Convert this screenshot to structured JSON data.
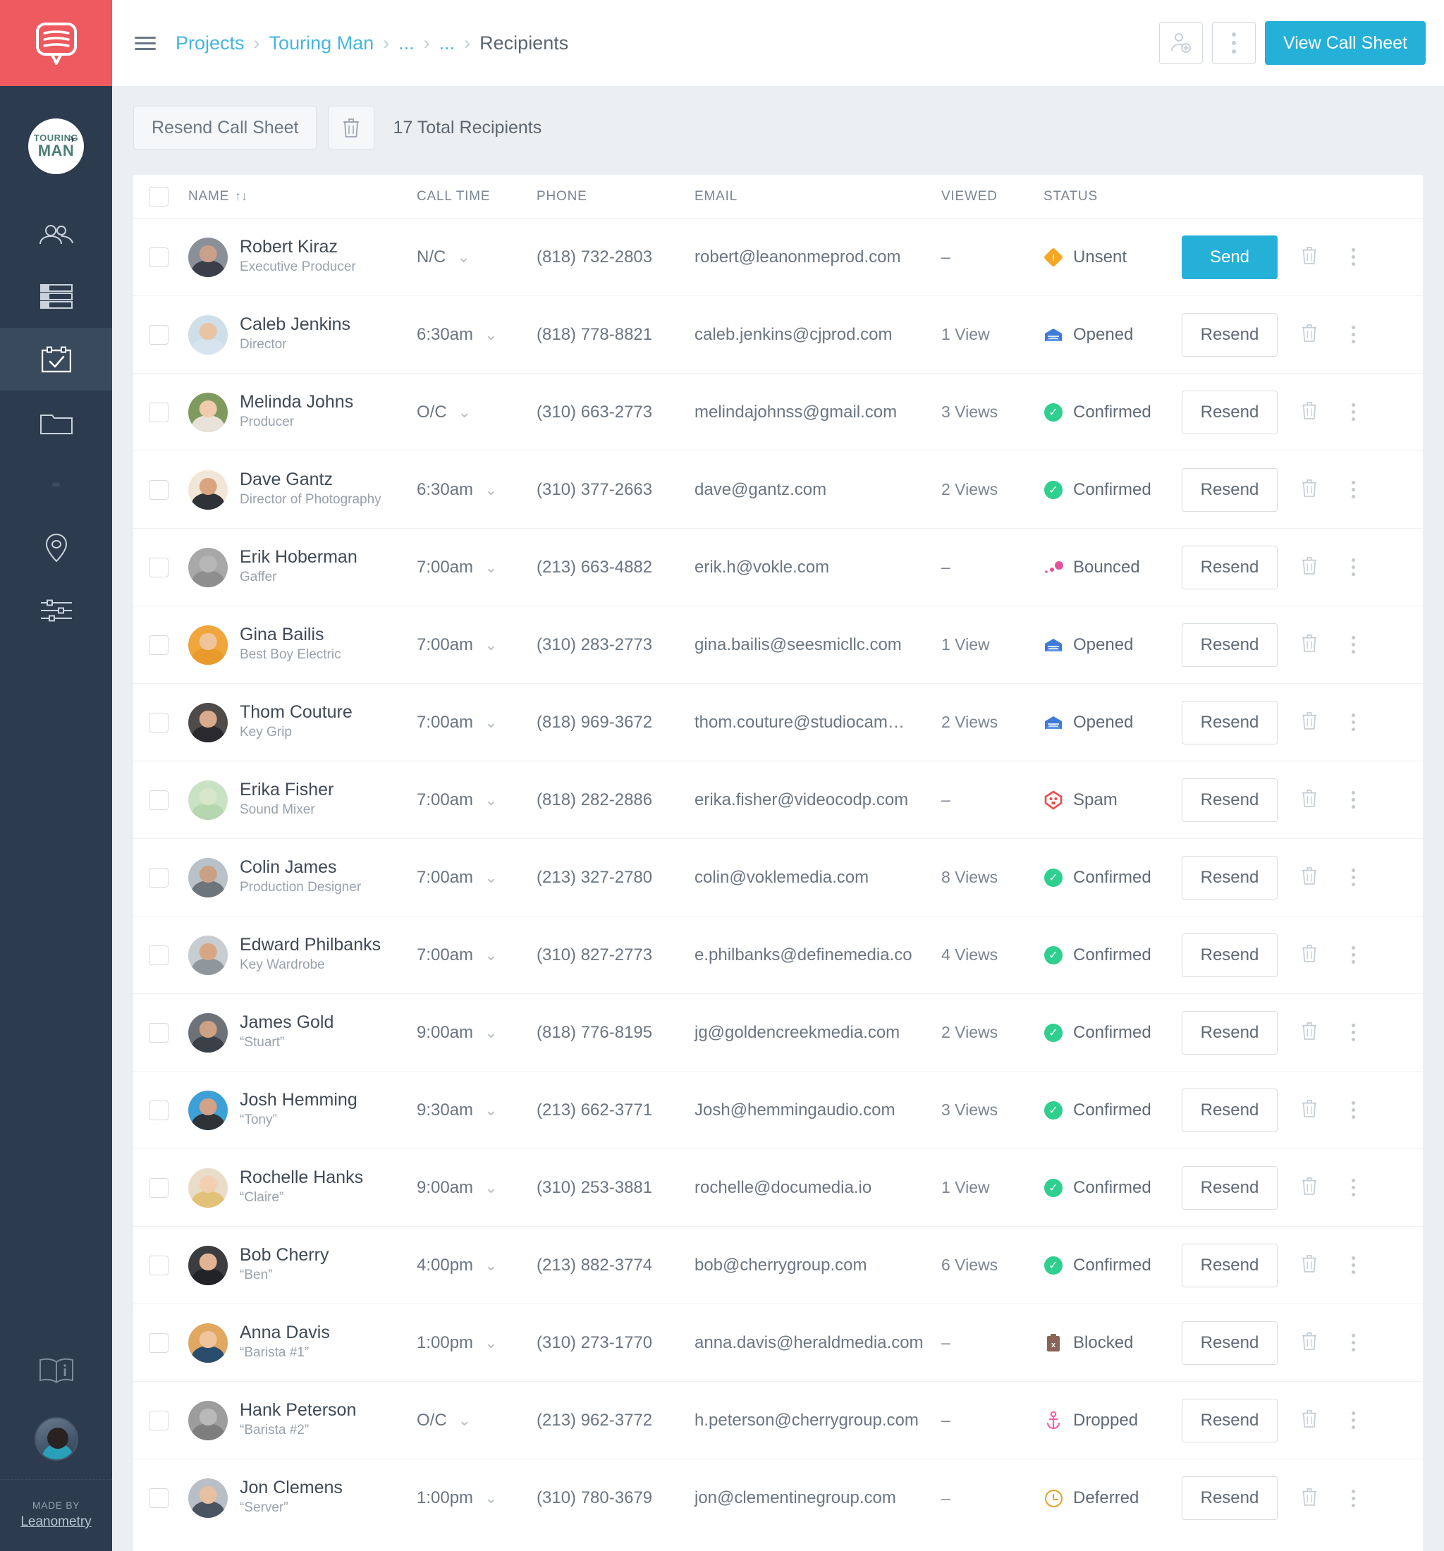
{
  "brand": {
    "logo_icon": "speech-bubble-logo",
    "accent_red": "#ee5a60",
    "accent_blue": "#25b0d8",
    "sidebar_bg": "#2c3b4d"
  },
  "sidebar": {
    "project_avatar": {
      "line1": "TOURING",
      "line2": "MAN",
      "icon": "airplane-icon"
    },
    "items": [
      {
        "name": "contacts",
        "icon": "people-icon",
        "active": false
      },
      {
        "name": "schedule",
        "icon": "rows-icon",
        "active": false
      },
      {
        "name": "call-sheets",
        "icon": "calendar-check-icon",
        "active": true
      },
      {
        "name": "files",
        "icon": "folder-icon",
        "active": false
      },
      {
        "name": "more",
        "icon": "dot-icon",
        "active": false
      },
      {
        "name": "locations",
        "icon": "map-pin-icon",
        "active": false
      },
      {
        "name": "settings",
        "icon": "sliders-icon",
        "active": false
      }
    ],
    "help_icon": "book-info-icon",
    "user_avatar_icon": "user-avatar",
    "footer": {
      "made_by": "MADE BY",
      "company": "Leanometry"
    }
  },
  "topbar": {
    "menu_icon": "hamburger-icon",
    "breadcrumbs": [
      {
        "label": "Projects",
        "current": false
      },
      {
        "label": "Touring Man",
        "current": false
      },
      {
        "label": "...",
        "current": false
      },
      {
        "label": "...",
        "current": false
      },
      {
        "label": "Recipients",
        "current": true
      }
    ],
    "add_person_icon": "add-person-icon",
    "more_icon": "kebab-menu-icon",
    "view_call_sheet_label": "View Call Sheet"
  },
  "toolbar": {
    "resend_label": "Resend Call Sheet",
    "delete_icon": "trash-icon",
    "total_recipients": "17 Total Recipients"
  },
  "table": {
    "columns": {
      "name": "NAME",
      "sort_glyph": "↑↓",
      "call_time": "CALL TIME",
      "phone": "PHONE",
      "email": "EMAIL",
      "viewed": "VIEWED",
      "status": "STATUS"
    },
    "action_labels": {
      "send": "Send",
      "resend": "Resend"
    },
    "row_icons": {
      "trash": "trash-icon",
      "kebab": "kebab-menu-icon",
      "chevron": "chevron-down-icon"
    },
    "status_colors": {
      "unsent": "#f5a623",
      "opened": "#3f7bd8",
      "confirmed": "#2ecf8f",
      "bounced": "#e0549a",
      "spam": "#ec4b4b",
      "blocked": "#8a6457",
      "dropped": "#f061a7",
      "deferred": "#e3a029"
    },
    "rows": [
      {
        "name": "Robert Kiraz",
        "role": "Executive Producer",
        "call_time": "N/C",
        "phone": "(818) 732-2803",
        "email": "robert@leanonmeprod.com",
        "viewed": "–",
        "status": "Unsent",
        "status_icon": "warning-diamond-icon",
        "action": "Send",
        "av_head": "#c9a08a",
        "av_body": "#3a3f4a",
        "av_bg": "#8a8f98"
      },
      {
        "name": "Caleb Jenkins",
        "role": "Director",
        "call_time": "6:30am",
        "phone": "(818) 778-8821",
        "email": "caleb.jenkins@cjprod.com",
        "viewed": "1 View",
        "status": "Opened",
        "status_icon": "opened-envelope-icon",
        "action": "Resend",
        "av_head": "#e8c3a4",
        "av_body": "#d7e3ee",
        "av_bg": "#cfdfe9"
      },
      {
        "name": "Melinda Johns",
        "role": "Producer",
        "call_time": "O/C",
        "phone": "(310) 663-2773",
        "email": "melindajohnss@gmail.com",
        "viewed": "3 Views",
        "status": "Confirmed",
        "status_icon": "check-circle-icon",
        "action": "Resend",
        "av_head": "#f0cbad",
        "av_body": "#e8e2d8",
        "av_bg": "#7f9a5e"
      },
      {
        "name": "Dave Gantz",
        "role": "Director of Photography",
        "call_time": "6:30am",
        "phone": "(310) 377-2663",
        "email": "dave@gantz.com",
        "viewed": "2 Views",
        "status": "Confirmed",
        "status_icon": "check-circle-icon",
        "action": "Resend",
        "av_head": "#d9a57f",
        "av_body": "#2f3236",
        "av_bg": "#f2e6d8"
      },
      {
        "name": "Erik Hoberman",
        "role": "Gaffer",
        "call_time": "7:00am",
        "phone": "(213) 663-4882",
        "email": "erik.h@vokle.com",
        "viewed": "–",
        "status": "Bounced",
        "status_icon": "bounced-dots-icon",
        "action": "Resend",
        "av_head": "#b7b7b7",
        "av_body": "#8e8e8e",
        "av_bg": "#a8a8a8"
      },
      {
        "name": "Gina Bailis",
        "role": "Best Boy Electric",
        "call_time": "7:00am",
        "phone": "(310) 283-2773",
        "email": "gina.bailis@seesmicllc.com",
        "viewed": "1 View",
        "status": "Opened",
        "status_icon": "opened-envelope-icon",
        "action": "Resend",
        "av_head": "#f0c49b",
        "av_body": "#e89a2c",
        "av_bg": "#f0a63c"
      },
      {
        "name": "Thom Couture",
        "role": "Key Grip",
        "call_time": "7:00am",
        "phone": "(818) 969-3672",
        "email": "thom.couture@studiocam…",
        "viewed": "2 Views",
        "status": "Opened",
        "status_icon": "opened-envelope-icon",
        "action": "Resend",
        "av_head": "#d9ab8c",
        "av_body": "#2a2a2e",
        "av_bg": "#4e4b48"
      },
      {
        "name": "Erika Fisher",
        "role": "Sound Mixer",
        "call_time": "7:00am",
        "phone": "(818) 282-2886",
        "email": "erika.fisher@videocodp.com",
        "viewed": "–",
        "status": "Spam",
        "status_icon": "spam-skull-icon",
        "action": "Resend",
        "av_head": "#d8e7c9",
        "av_body": "#b6d6b0",
        "av_bg": "#c9e2c4"
      },
      {
        "name": "Colin James",
        "role": "Production Designer",
        "call_time": "7:00am",
        "phone": "(213) 327-2780",
        "email": "colin@voklemedia.com",
        "viewed": "8 Views",
        "status": "Confirmed",
        "status_icon": "check-circle-icon",
        "action": "Resend",
        "av_head": "#caa184",
        "av_body": "#6e747c",
        "av_bg": "#b9c2c9"
      },
      {
        "name": "Edward Philbanks",
        "role": "Key Wardrobe",
        "call_time": "7:00am",
        "phone": "(310) 827-2773",
        "email": "e.philbanks@definemedia.co",
        "viewed": "4 Views",
        "status": "Confirmed",
        "status_icon": "check-circle-icon",
        "action": "Resend",
        "av_head": "#d7a783",
        "av_body": "#8f979e",
        "av_bg": "#c7cdd1"
      },
      {
        "name": "James Gold",
        "role": "“Stuart”",
        "call_time": "9:00am",
        "phone": "(818) 776-8195",
        "email": "jg@goldencreekmedia.com",
        "viewed": "2 Views",
        "status": "Confirmed",
        "status_icon": "check-circle-icon",
        "action": "Resend",
        "av_head": "#cda183",
        "av_body": "#3a4048",
        "av_bg": "#6d7278"
      },
      {
        "name": "Josh Hemming",
        "role": "“Tony”",
        "call_time": "9:30am",
        "phone": "(213) 662-3771",
        "email": "Josh@hemmingaudio.com",
        "viewed": "3 Views",
        "status": "Confirmed",
        "status_icon": "check-circle-icon",
        "action": "Resend",
        "av_head": "#d3a185",
        "av_body": "#2e3338",
        "av_bg": "#3da0d6"
      },
      {
        "name": "Rochelle Hanks",
        "role": "“Claire”",
        "call_time": "9:00am",
        "phone": "(310) 253-3881",
        "email": "rochelle@documedia.io",
        "viewed": "1 View",
        "status": "Confirmed",
        "status_icon": "check-circle-icon",
        "action": "Resend",
        "av_head": "#f2cfae",
        "av_body": "#e2c178",
        "av_bg": "#e9dcc8"
      },
      {
        "name": "Bob Cherry",
        "role": "“Ben”",
        "call_time": "4:00pm",
        "phone": "(213) 882-3774",
        "email": "bob@cherrygroup.com",
        "viewed": "6 Views",
        "status": "Confirmed",
        "status_icon": "check-circle-icon",
        "action": "Resend",
        "av_head": "#e2b494",
        "av_body": "#222326",
        "av_bg": "#3b3d40"
      },
      {
        "name": "Anna Davis",
        "role": "“Barista #1”",
        "call_time": "1:00pm",
        "phone": "(310) 273-1770",
        "email": "anna.davis@heraldmedia.com",
        "viewed": "–",
        "status": "Blocked",
        "status_icon": "blocked-clipboard-icon",
        "action": "Resend",
        "av_head": "#f0c49d",
        "av_body": "#2a4d6e",
        "av_bg": "#e0a860"
      },
      {
        "name": "Hank Peterson",
        "role": "“Barista #2”",
        "call_time": "O/C",
        "phone": "(213) 962-3772",
        "email": "h.peterson@cherrygroup.com",
        "viewed": "–",
        "status": "Dropped",
        "status_icon": "dropped-anchor-icon",
        "action": "Resend",
        "av_head": "#b9b9b9",
        "av_body": "#7e7e7e",
        "av_bg": "#9d9d9d"
      },
      {
        "name": "Jon Clemens",
        "role": "“Server”",
        "call_time": "1:00pm",
        "phone": "(310) 780-3679",
        "email": "jon@clementinegroup.com",
        "viewed": "–",
        "status": "Deferred",
        "status_icon": "clock-icon",
        "action": "Resend",
        "av_head": "#e6c0a0",
        "av_body": "#4a5460",
        "av_bg": "#b9bfc6"
      }
    ]
  }
}
